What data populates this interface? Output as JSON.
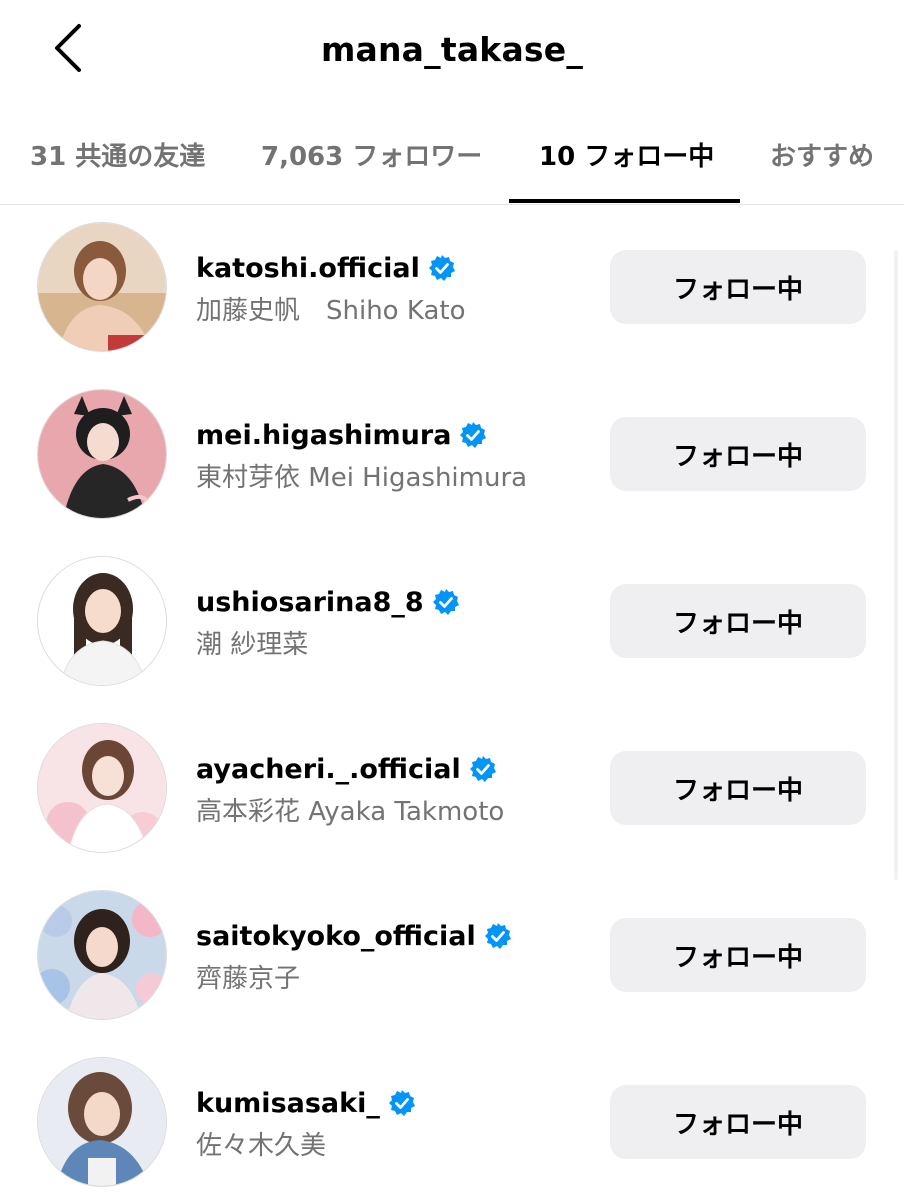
{
  "header": {
    "title": "mana_takase_",
    "back_icon": "chevron-left-icon"
  },
  "tabs": [
    {
      "label": "31 共通の友達",
      "active": false
    },
    {
      "label": "7,063 フォロワー",
      "active": false
    },
    {
      "label": "10 フォロー中",
      "active": true
    },
    {
      "label": "おすすめ",
      "active": false
    }
  ],
  "accounts": [
    {
      "username": "katoshi.official",
      "fullname": "加藤史帆　Shiho Kato",
      "verified": true,
      "button": "フォロー中"
    },
    {
      "username": "mei.higashimura",
      "fullname": "東村芽依  Mei Higashimura",
      "verified": true,
      "button": "フォロー中"
    },
    {
      "username": "ushiosarina8_8",
      "fullname": "潮 紗理菜",
      "verified": true,
      "button": "フォロー中"
    },
    {
      "username": "ayacheri._.official",
      "fullname": "高本彩花 Ayaka Takmoto",
      "verified": true,
      "button": "フォロー中"
    },
    {
      "username": "saitokyoko_official",
      "fullname": "齊藤京子",
      "verified": true,
      "button": "フォロー中"
    },
    {
      "username": "kumisasaki_",
      "fullname": "佐々木久美",
      "verified": true,
      "button": "フォロー中"
    }
  ],
  "colors": {
    "verified_blue": "#0095f6",
    "secondary_text": "#737373",
    "button_bg": "#efeff2"
  }
}
